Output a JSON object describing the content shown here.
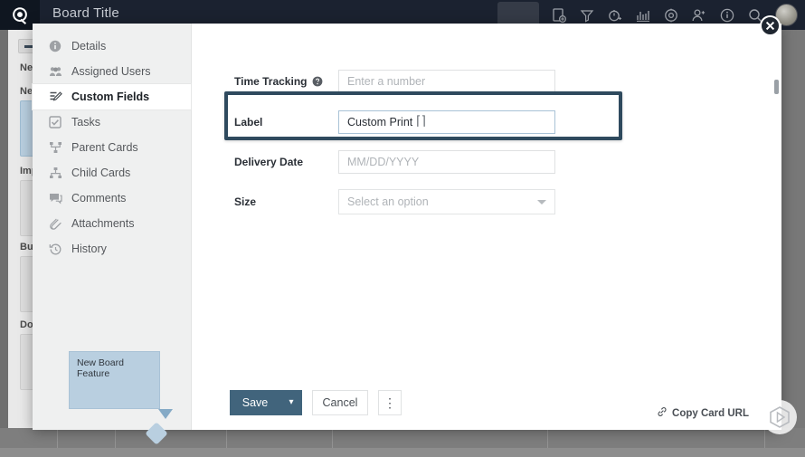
{
  "topbar": {
    "board_title": "Board Title",
    "icons": [
      {
        "name": "card-add-icon",
        "glyph": "card+"
      },
      {
        "name": "filter-icon",
        "glyph": "funnel"
      },
      {
        "name": "timer-icon",
        "glyph": "stopwatch"
      },
      {
        "name": "analytics-icon",
        "glyph": "bars"
      },
      {
        "name": "settings-icon",
        "glyph": "gear"
      },
      {
        "name": "add-user-icon",
        "glyph": "person+"
      },
      {
        "name": "info-icon",
        "glyph": "i-circle"
      },
      {
        "name": "search-icon",
        "glyph": "magnifier"
      }
    ],
    "avatar_label": "user-avatar"
  },
  "background_board": {
    "column_header": "Ne",
    "cards": [
      {
        "label": "New",
        "highlight": true
      },
      {
        "label": "Imp",
        "highlight": false
      },
      {
        "label": "Bug",
        "highlight": false
      },
      {
        "label": "Doc",
        "highlight": false
      }
    ]
  },
  "modal": {
    "close_label": "✕",
    "sidebar": {
      "items": [
        {
          "label": "Details",
          "icon": "info-icon",
          "active": false
        },
        {
          "label": "Assigned Users",
          "icon": "users-icon",
          "active": false
        },
        {
          "label": "Custom Fields",
          "icon": "edit-list-icon",
          "active": true
        },
        {
          "label": "Tasks",
          "icon": "checkbox-icon",
          "active": false
        },
        {
          "label": "Parent Cards",
          "icon": "parent-hierarchy-icon",
          "active": false
        },
        {
          "label": "Child Cards",
          "icon": "child-hierarchy-icon",
          "active": false
        },
        {
          "label": "Comments",
          "icon": "comment-icon",
          "active": false
        },
        {
          "label": "Attachments",
          "icon": "paperclip-icon",
          "active": false
        },
        {
          "label": "History",
          "icon": "clock-rewind-icon",
          "active": false
        }
      ]
    },
    "fields": [
      {
        "label": "Time Tracking",
        "has_help": true,
        "type": "text",
        "value": "",
        "placeholder": "Enter a number",
        "focused": false
      },
      {
        "label": "Label",
        "has_help": false,
        "type": "text",
        "value": "Custom Print",
        "placeholder": "",
        "focused": true
      },
      {
        "label": "Delivery Date",
        "has_help": false,
        "type": "text",
        "value": "",
        "placeholder": "MM/DD/YYYY",
        "focused": false
      },
      {
        "label": "Size",
        "has_help": false,
        "type": "select",
        "value": "",
        "placeholder": "Select an option",
        "focused": false
      }
    ],
    "preview_card": {
      "title": "New Board Feature"
    },
    "footer": {
      "save_label": "Save",
      "save_dropdown_label": "▾",
      "cancel_label": "Cancel",
      "more_label": "⋮",
      "copy_url_label": "Copy Card URL"
    }
  },
  "colors": {
    "topbar_bg": "#1b2230",
    "primary_button": "#41647c",
    "highlight_border": "#2f4a5e",
    "card_blue": "#b9cfe0",
    "focus_border": "#a9c2d6"
  }
}
